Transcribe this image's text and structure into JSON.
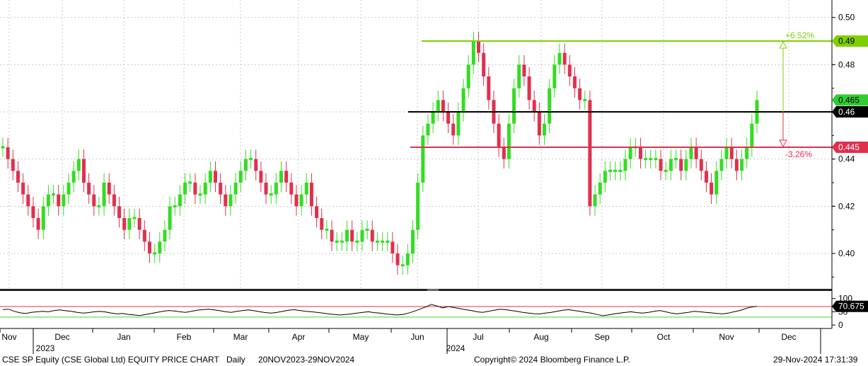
{
  "chart_data": {
    "type": "candlestick",
    "security": "CSE SP Equity (CSE Global Ltd) EQUITY PRICE CHART",
    "frequency": "Daily",
    "date_range": "20NOV2023-29NOV2024",
    "copyright": "Copyright© 2024 Bloomberg Finance L.P.",
    "timestamp": "29-Nov-2024 17:31:39",
    "x_months": [
      "Nov",
      "Dec",
      "Jan",
      "Feb",
      "Mar",
      "Apr",
      "May",
      "Jun",
      "Jul",
      "Aug",
      "Sep",
      "Oct",
      "Nov",
      "Dec"
    ],
    "x_years": [
      "2023",
      "2024"
    ],
    "price_axis": {
      "ylim": [
        0.385,
        0.505
      ],
      "ticks": [
        "0.50",
        "0.48",
        "0.46",
        "0.44",
        "0.42",
        "0.40"
      ]
    },
    "levels": [
      {
        "label": "0.49",
        "value": 0.49,
        "color": "#7fd000",
        "tag_bg": "#7fd000",
        "tag_fg": "#000000"
      },
      {
        "label": "0.46",
        "value": 0.46,
        "color": "#000000",
        "tag_bg": "#000000",
        "tag_fg": "#ffffff"
      },
      {
        "label": "0.445",
        "value": 0.445,
        "color": "#e0304e",
        "tag_bg": "#e0304e",
        "tag_fg": "#ffffff"
      }
    ],
    "last_price": {
      "label": "0.465",
      "value": 0.465,
      "tag_bg": "#33cc33",
      "tag_fg": "#000000"
    },
    "annotations": [
      {
        "text": "+6.52%",
        "color": "#7fd000"
      },
      {
        "text": "-3.26%",
        "color": "#e0304e"
      }
    ],
    "colors": {
      "up": "#33dd22",
      "down": "#e0304e",
      "grid": "#c8c8c8"
    },
    "closes": [
      0.445,
      0.44,
      0.435,
      0.43,
      0.425,
      0.42,
      0.415,
      0.41,
      0.42,
      0.425,
      0.425,
      0.42,
      0.425,
      0.43,
      0.435,
      0.44,
      0.43,
      0.425,
      0.42,
      0.42,
      0.43,
      0.425,
      0.42,
      0.415,
      0.41,
      0.415,
      0.415,
      0.41,
      0.405,
      0.4,
      0.4,
      0.405,
      0.41,
      0.42,
      0.42,
      0.425,
      0.43,
      0.43,
      0.425,
      0.425,
      0.43,
      0.435,
      0.43,
      0.425,
      0.42,
      0.425,
      0.43,
      0.435,
      0.44,
      0.44,
      0.435,
      0.43,
      0.425,
      0.425,
      0.43,
      0.435,
      0.43,
      0.425,
      0.42,
      0.425,
      0.43,
      0.42,
      0.415,
      0.41,
      0.41,
      0.405,
      0.405,
      0.405,
      0.41,
      0.405,
      0.405,
      0.41,
      0.41,
      0.405,
      0.405,
      0.405,
      0.405,
      0.4,
      0.395,
      0.395,
      0.4,
      0.41,
      0.43,
      0.45,
      0.455,
      0.46,
      0.465,
      0.46,
      0.455,
      0.45,
      0.46,
      0.47,
      0.48,
      0.49,
      0.485,
      0.475,
      0.465,
      0.455,
      0.445,
      0.44,
      0.455,
      0.47,
      0.48,
      0.475,
      0.465,
      0.46,
      0.45,
      0.455,
      0.47,
      0.48,
      0.485,
      0.48,
      0.475,
      0.47,
      0.465,
      0.465,
      0.42,
      0.425,
      0.43,
      0.435,
      0.435,
      0.435,
      0.435,
      0.44,
      0.445,
      0.445,
      0.44,
      0.44,
      0.44,
      0.44,
      0.435,
      0.435,
      0.44,
      0.44,
      0.435,
      0.44,
      0.445,
      0.44,
      0.435,
      0.43,
      0.425,
      0.435,
      0.44,
      0.445,
      0.44,
      0.435,
      0.44,
      0.445,
      0.455,
      0.465
    ],
    "rsi": {
      "label": "70.675",
      "value": 70.675,
      "ylim": [
        -5,
        110
      ],
      "ticks": [
        "100",
        "50",
        "0"
      ],
      "bands": [
        70,
        30
      ],
      "values": [
        58,
        60,
        52,
        46,
        44,
        48,
        50,
        52,
        50,
        55,
        57,
        54,
        52,
        48,
        45,
        47,
        50,
        52,
        49,
        45,
        42,
        44,
        40,
        38,
        36,
        40,
        44,
        48,
        52,
        55,
        53,
        50,
        48,
        52,
        56,
        58,
        60,
        57,
        54,
        50,
        48,
        52,
        55,
        57,
        54,
        50,
        47,
        45,
        48,
        52,
        56,
        58,
        55,
        52,
        50,
        48,
        45,
        42,
        40,
        38,
        40,
        42,
        45,
        48,
        50,
        47,
        45,
        42,
        40,
        38,
        40,
        45,
        52,
        60,
        68,
        78,
        72,
        65,
        70,
        66,
        62,
        58,
        55,
        50,
        48,
        52,
        56,
        60,
        58,
        55,
        52,
        48,
        45,
        43,
        42,
        45,
        48,
        52,
        56,
        58,
        55,
        52,
        48,
        45,
        40,
        35,
        38,
        42,
        45,
        48,
        50,
        47,
        45,
        48,
        52,
        55,
        50,
        45,
        42,
        45,
        48,
        52,
        50,
        48,
        46,
        44,
        42,
        45,
        50,
        55,
        62,
        68,
        70.675
      ]
    }
  }
}
